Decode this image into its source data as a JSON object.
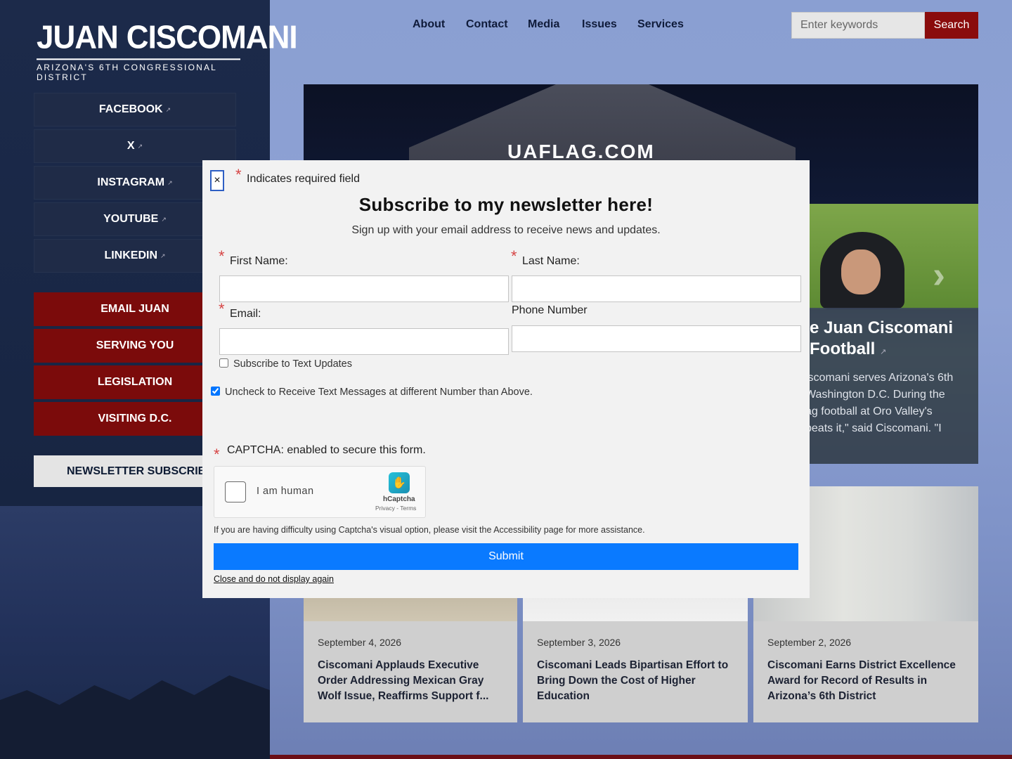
{
  "logo": {
    "name_first": "JUAN",
    "name_last": "CISCOMANI",
    "tagline": "ARIZONA'S 6TH CONGRESSIONAL DISTRICT"
  },
  "social": [
    {
      "label": "FACEBOOK"
    },
    {
      "label": "X"
    },
    {
      "label": "INSTAGRAM"
    },
    {
      "label": "YOUTUBE"
    },
    {
      "label": "LINKEDIN"
    }
  ],
  "external_glyph": "↗",
  "sidebar_actions": [
    {
      "label": "EMAIL JUAN"
    },
    {
      "label": "SERVING YOU"
    },
    {
      "label": "LEGISLATION"
    },
    {
      "label": "VISITING D.C."
    }
  ],
  "newsletter_button": "NEWSLETTER SUBSCRIBE",
  "nav": [
    "About",
    "Contact",
    "Media",
    "Issues",
    "Services"
  ],
  "search": {
    "placeholder": "Enter keywords",
    "button": "Search"
  },
  "hero": {
    "tent_text": "UAFLAG.COM",
    "title_line1": "e Juan Ciscomani",
    "title_line2": "Football",
    "text_lines": [
      "iscomani serves Arizona's 6th",
      "Washington D.C. During the",
      "ag football at Oro Valley's",
      "beats it,\" said Ciscomani. \"I"
    ],
    "next_arrow": "›"
  },
  "news": [
    {
      "date": "September 4, 2026",
      "title": "Ciscomani Applauds Executive Order Addressing Mexican Gray Wolf Issue, Reaffirms Support f..."
    },
    {
      "date": "September 3, 2026",
      "title": "Ciscomani Leads Bipartisan Effort to Bring Down the Cost of Higher Education"
    },
    {
      "date": "September 2, 2026",
      "title": "Ciscomani Earns District Excellence Award for Record of Results in Arizona’s 6th District"
    }
  ],
  "modal": {
    "close": "×",
    "required_star": "*",
    "required_note": "Indicates required field",
    "title": "Subscribe to my newsletter here!",
    "subtitle": "Sign up with your email address to receive news and updates.",
    "first_name_label": "First Name:",
    "last_name_label": "Last Name:",
    "email_label": "Email:",
    "phone_label": "Phone Number",
    "text_updates_label": "Subscribe to Text Updates",
    "uncheck_label": "Uncheck to Receive Text Messages at different Number than Above.",
    "text_updates_checked": false,
    "uncheck_checked": true,
    "captcha_label": "CAPTCHA: enabled to secure this form.",
    "captcha_checkbox_label": "I am human",
    "captcha_brand": "hCaptcha",
    "captcha_links": "Privacy - Terms",
    "accessibility_note": "If you are having difficulty using Captcha's visual option, please visit the Accessibility page for more assistance.",
    "submit": "Submit",
    "close_forever": "Close and do not display again"
  },
  "colors": {
    "accent_red": "#7b0b0b",
    "submit_blue": "#0a7aff",
    "navy": "#1c2a4a"
  }
}
